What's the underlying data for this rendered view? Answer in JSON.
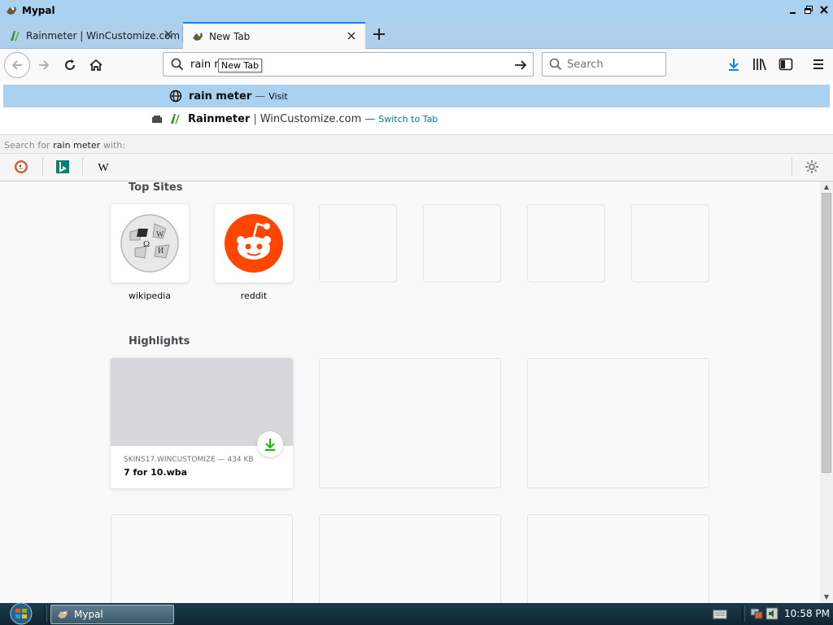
{
  "window": {
    "title": "Mypal",
    "controls": [
      "minimize",
      "restore",
      "close"
    ]
  },
  "tabs": [
    {
      "label": "Rainmeter | WinCustomize.com",
      "active": false
    },
    {
      "label": "New Tab",
      "active": true
    }
  ],
  "navbar": {
    "url_text": "rain m",
    "tooltip": "New Tab",
    "search_placeholder": "Search"
  },
  "dropdown": {
    "suggestions": [
      {
        "title": "rain meter",
        "separator": "—",
        "action": "Visit"
      },
      {
        "title": "Rainmeter",
        "pipe": "|",
        "url": "WinCustomize.com",
        "separator": "—",
        "action": "Switch to Tab"
      }
    ],
    "search_for_prefix": "Search for",
    "search_for_term": "rain meter",
    "search_for_suffix": "with:",
    "engines": [
      "duckduckgo-icon",
      "bing-icon",
      "wikipedia-icon"
    ]
  },
  "content": {
    "top_sites_title": "Top Sites",
    "top_sites": [
      {
        "label": "wikipedia"
      },
      {
        "label": "reddit"
      },
      {
        "label": ""
      },
      {
        "label": ""
      },
      {
        "label": ""
      },
      {
        "label": ""
      }
    ],
    "highlights_title": "Highlights",
    "highlights": [
      {
        "source": "SKINS17.WINCUSTOMIZE — 434 KB",
        "title": "7 for 10.wba"
      }
    ]
  },
  "taskbar": {
    "task_label": "Mypal",
    "clock": "10:58 PM"
  },
  "colors": {
    "accent": "#0a84ff",
    "selection": "#aad1f0",
    "switch_tab": "#008080",
    "download_green": "#12bc00",
    "reddit": "#ff4500"
  }
}
